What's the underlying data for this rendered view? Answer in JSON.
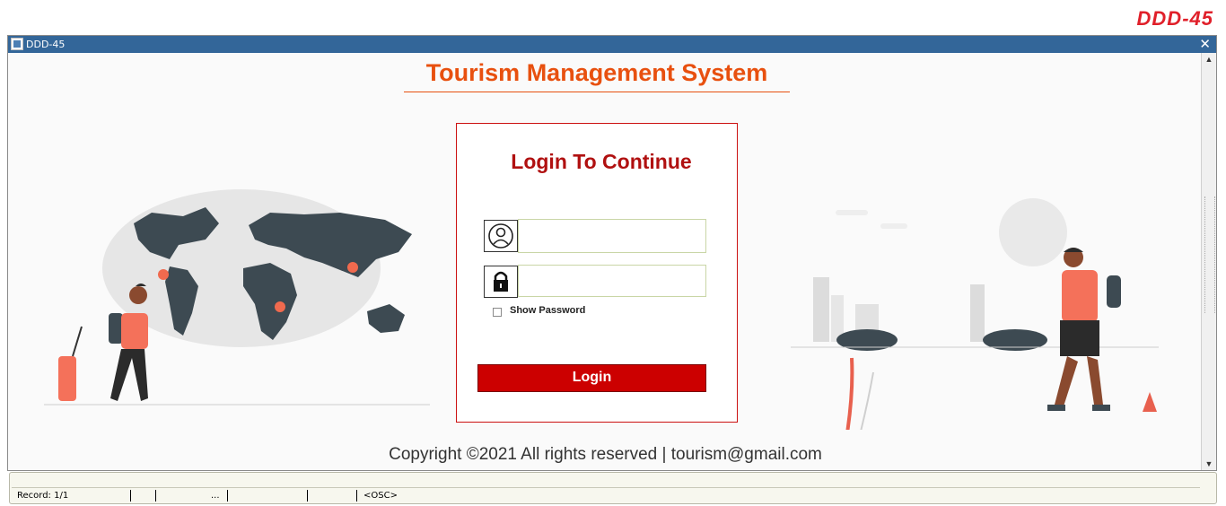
{
  "corner_brand": "DDD-45",
  "window": {
    "title": "DDD-45",
    "close_glyph": "✕"
  },
  "app_title": "Tourism Management System",
  "login": {
    "heading": "Login To Continue",
    "username_value": "",
    "password_value": "",
    "show_password_label": "Show Password",
    "show_password_checked": false,
    "login_button_label": "Login"
  },
  "copyright": "Copyright ©2021 All rights reserved | tourism@gmail.com",
  "status_bar": {
    "record": "Record: 1/1",
    "ellipsis": "...",
    "osc": "<OSC>"
  },
  "icons": {
    "user": "user-avatar-icon",
    "lock": "lock-icon",
    "scroll_up": "▲",
    "scroll_down": "▼"
  },
  "colors": {
    "title_bar": "#336699",
    "app_title": "#e8500f",
    "login_accent": "#cc0000",
    "brand": "#e0202a"
  }
}
